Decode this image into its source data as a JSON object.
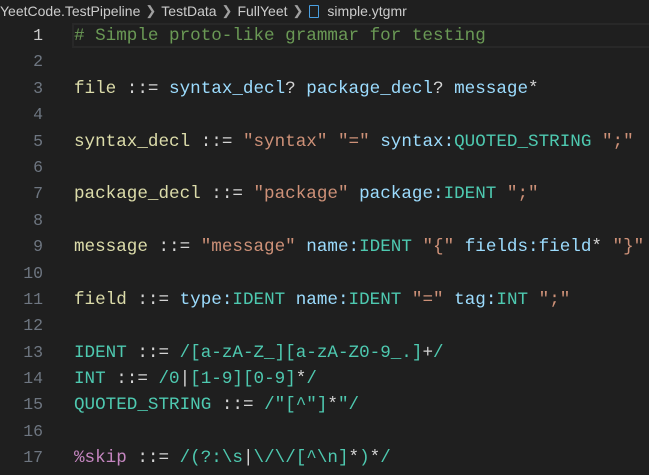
{
  "breadcrumb": [
    "YeetCode.TestPipeline",
    "TestData",
    "FullYeet",
    "simple.ytgmr"
  ],
  "current_line": 1,
  "lines": [
    [
      {
        "t": "# Simple proto-like grammar for testing",
        "c": "comment"
      }
    ],
    [],
    [
      {
        "t": "file",
        "c": "rule"
      },
      {
        "t": " ::= ",
        "c": "op"
      },
      {
        "t": "syntax_decl",
        "c": "ref"
      },
      {
        "t": "? ",
        "c": "op"
      },
      {
        "t": "package_decl",
        "c": "ref"
      },
      {
        "t": "? ",
        "c": "op"
      },
      {
        "t": "message",
        "c": "ref"
      },
      {
        "t": "*",
        "c": "op"
      }
    ],
    [],
    [
      {
        "t": "syntax_decl",
        "c": "rule"
      },
      {
        "t": " ::= ",
        "c": "op"
      },
      {
        "t": "\"syntax\"",
        "c": "str"
      },
      {
        "t": " ",
        "c": "op"
      },
      {
        "t": "\"=\"",
        "c": "str"
      },
      {
        "t": " ",
        "c": "op"
      },
      {
        "t": "syntax:",
        "c": "ref"
      },
      {
        "t": "QUOTED_STRING",
        "c": "tok"
      },
      {
        "t": " ",
        "c": "op"
      },
      {
        "t": "\";\"",
        "c": "str"
      }
    ],
    [],
    [
      {
        "t": "package_decl",
        "c": "rule"
      },
      {
        "t": " ::= ",
        "c": "op"
      },
      {
        "t": "\"package\"",
        "c": "str"
      },
      {
        "t": " ",
        "c": "op"
      },
      {
        "t": "package:",
        "c": "ref"
      },
      {
        "t": "IDENT",
        "c": "tok"
      },
      {
        "t": " ",
        "c": "op"
      },
      {
        "t": "\";\"",
        "c": "str"
      }
    ],
    [],
    [
      {
        "t": "message",
        "c": "rule"
      },
      {
        "t": " ::= ",
        "c": "op"
      },
      {
        "t": "\"message\"",
        "c": "str"
      },
      {
        "t": " ",
        "c": "op"
      },
      {
        "t": "name:",
        "c": "ref"
      },
      {
        "t": "IDENT",
        "c": "tok"
      },
      {
        "t": " ",
        "c": "op"
      },
      {
        "t": "\"{\"",
        "c": "str"
      },
      {
        "t": " ",
        "c": "op"
      },
      {
        "t": "fields:field",
        "c": "ref"
      },
      {
        "t": "* ",
        "c": "op"
      },
      {
        "t": "\"}\"",
        "c": "str"
      }
    ],
    [],
    [
      {
        "t": "field",
        "c": "rule"
      },
      {
        "t": " ::= ",
        "c": "op"
      },
      {
        "t": "type:",
        "c": "ref"
      },
      {
        "t": "IDENT",
        "c": "tok"
      },
      {
        "t": " ",
        "c": "op"
      },
      {
        "t": "name:",
        "c": "ref"
      },
      {
        "t": "IDENT",
        "c": "tok"
      },
      {
        "t": " ",
        "c": "op"
      },
      {
        "t": "\"=\"",
        "c": "str"
      },
      {
        "t": " ",
        "c": "op"
      },
      {
        "t": "tag:",
        "c": "ref"
      },
      {
        "t": "INT",
        "c": "tok"
      },
      {
        "t": " ",
        "c": "op"
      },
      {
        "t": "\";\"",
        "c": "str"
      }
    ],
    [],
    [
      {
        "t": "IDENT",
        "c": "tok"
      },
      {
        "t": " ::= ",
        "c": "op"
      },
      {
        "t": "/[a-zA-Z_][a-zA-Z0-9_.]",
        "c": "re"
      },
      {
        "t": "+",
        "c": "op"
      },
      {
        "t": "/",
        "c": "re"
      }
    ],
    [
      {
        "t": "INT",
        "c": "tok"
      },
      {
        "t": " ::= ",
        "c": "op"
      },
      {
        "t": "/0",
        "c": "re"
      },
      {
        "t": "|",
        "c": "op"
      },
      {
        "t": "[1-9][0-9]",
        "c": "re"
      },
      {
        "t": "*",
        "c": "op"
      },
      {
        "t": "/",
        "c": "re"
      }
    ],
    [
      {
        "t": "QUOTED_STRING",
        "c": "tok"
      },
      {
        "t": " ::= ",
        "c": "op"
      },
      {
        "t": "/\"[^\"]",
        "c": "re"
      },
      {
        "t": "*",
        "c": "op"
      },
      {
        "t": "\"/",
        "c": "re"
      }
    ],
    [],
    [
      {
        "t": "%skip",
        "c": "dir"
      },
      {
        "t": " ::= ",
        "c": "op"
      },
      {
        "t": "/(?:\\s",
        "c": "re"
      },
      {
        "t": "|",
        "c": "op"
      },
      {
        "t": "\\/\\/[^\\n]",
        "c": "re"
      },
      {
        "t": "*",
        "c": "op"
      },
      {
        "t": ")",
        "c": "re"
      },
      {
        "t": "*",
        "c": "op"
      },
      {
        "t": "/",
        "c": "re"
      }
    ]
  ]
}
